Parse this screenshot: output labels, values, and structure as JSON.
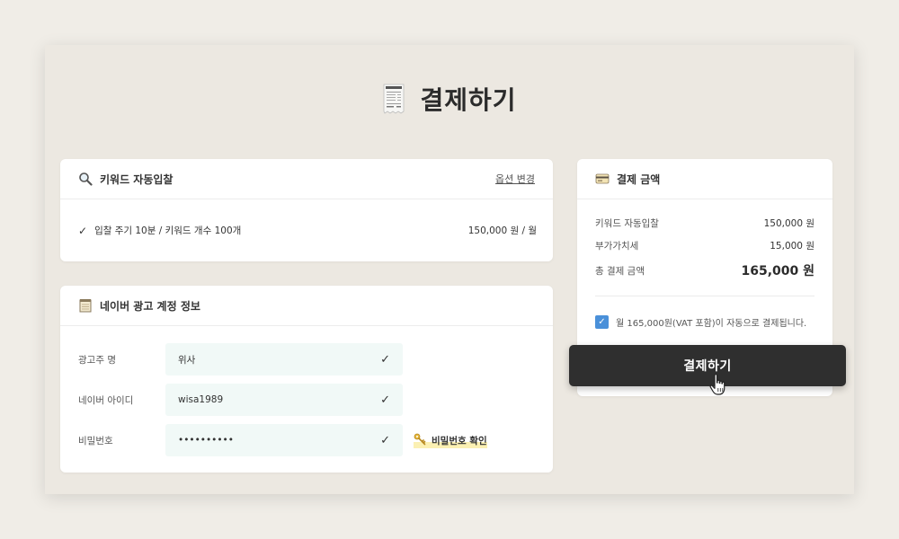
{
  "page": {
    "title": "결제하기"
  },
  "keyword_card": {
    "title": "키워드 자동입찰",
    "option_link": "옵션 변경",
    "item_check": "✓",
    "item_label": "입찰 주기 10분 / 키워드 개수 100개",
    "item_price": "150,000 원 / 월"
  },
  "account_card": {
    "title": "네이버 광고 계정 정보",
    "fields": [
      {
        "label": "광고주 명",
        "value": "위사"
      },
      {
        "label": "네이버 아이디",
        "value": "wisa1989"
      },
      {
        "label": "비밀번호",
        "value": "••••••••••"
      }
    ],
    "check_glyph": "✓",
    "password_confirm": "비밀번호 확인"
  },
  "payment_card": {
    "title": "결제 금액",
    "rows": [
      {
        "label": "키워드 자동입찰",
        "value": "150,000 원"
      },
      {
        "label": "부가가치세",
        "value": "15,000 원"
      },
      {
        "label": "총 결제 금액",
        "value": "165,000 원"
      }
    ],
    "agree_text": "월 165,000원(VAT 포함)이 자동으로 결제됩니다.",
    "agree_checked": true,
    "button_label": "결제하기"
  },
  "colors": {
    "background": "#ece8e1",
    "button": "#2f2f2f",
    "field_bg": "#f1f9f7",
    "checkbox": "#4a90d9"
  },
  "icons": [
    "receipt-icon",
    "search-icon",
    "notepad-icon",
    "credit-card-icon",
    "check-icon",
    "key-icon",
    "hand-pointer-icon"
  ]
}
